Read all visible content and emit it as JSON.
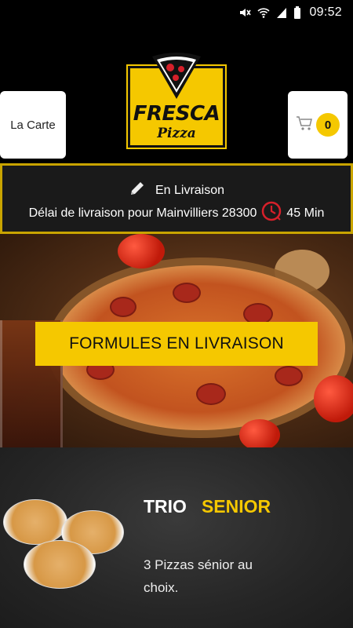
{
  "status_bar": {
    "time": "09:52",
    "icons": [
      "mute-icon",
      "wifi-icon",
      "signal-icon",
      "battery-icon"
    ]
  },
  "header": {
    "menu_button_label": "La Carte",
    "cart_count": "0",
    "logo": {
      "title": "FRESCA",
      "subtitle": "Pizza"
    }
  },
  "delivery": {
    "mode": "En Livraison",
    "delay_text": "Délai de livraison pour Mainvilliers 28300",
    "delay_time": "45 Min"
  },
  "hero": {
    "button_label": "FORMULES EN LIVRAISON"
  },
  "offer": {
    "title_part1": "TRIO",
    "title_part2": "SENIOR",
    "description": "3 Pizzas sénior au choix."
  },
  "colors": {
    "accent": "#f5c800",
    "background": "#000000",
    "delivery_border": "#c9a400"
  }
}
